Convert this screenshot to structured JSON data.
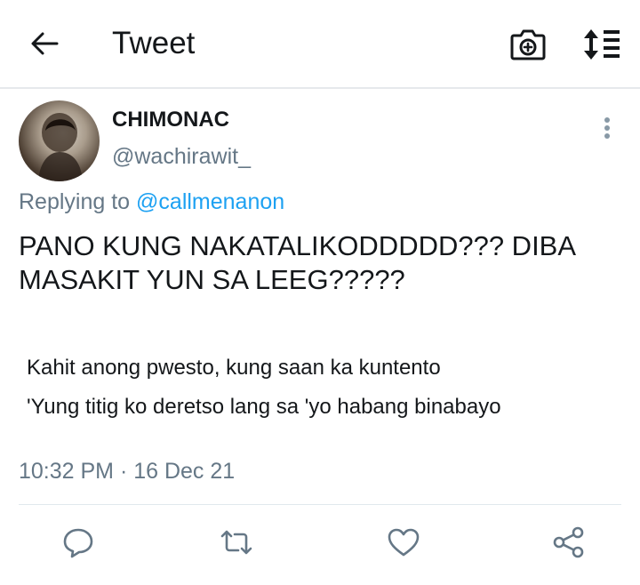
{
  "header": {
    "title": "Tweet",
    "back_icon": "arrow-left-icon",
    "camera_icon": "camera-plus-icon",
    "sort_icon": "sort-list-icon"
  },
  "tweet": {
    "display_name": "CHIMONAC",
    "handle": "@wachirawit_",
    "replying_label": "Replying to",
    "replying_to": "@callmenanon",
    "text": "PANO KUNG NAKATALIKODDDDD??? DIBA MASAKIT YUN SA LEEG?????",
    "lyrics": [
      "Kahit anong pwesto, kung saan ka kuntento",
      "'Yung titig ko deretso lang sa 'yo habang binabayo"
    ],
    "timestamp": "10:32 PM · 16 Dec 21"
  },
  "actions": [
    "reply-icon",
    "retweet-icon",
    "like-icon",
    "share-icon"
  ],
  "colors": {
    "text": "#14171a",
    "secondary": "#657786",
    "link": "#1da1f2",
    "divider": "#e1e8ed"
  }
}
